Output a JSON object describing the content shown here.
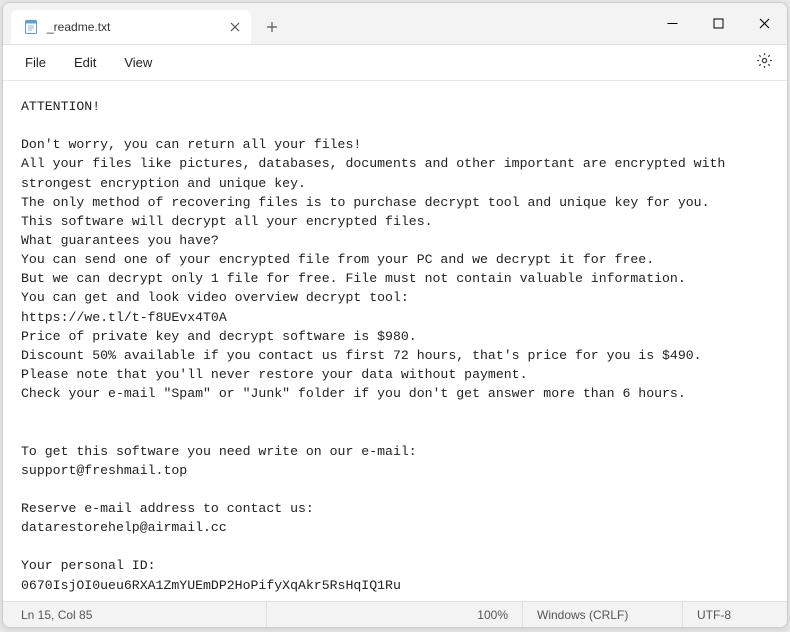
{
  "tab": {
    "title": "_readme.txt"
  },
  "menu": {
    "file": "File",
    "edit": "Edit",
    "view": "View"
  },
  "body": {
    "text": "ATTENTION!\n\nDon't worry, you can return all your files!\nAll your files like pictures, databases, documents and other important are encrypted with strongest encryption and unique key.\nThe only method of recovering files is to purchase decrypt tool and unique key for you.\nThis software will decrypt all your encrypted files.\nWhat guarantees you have?\nYou can send one of your encrypted file from your PC and we decrypt it for free.\nBut we can decrypt only 1 file for free. File must not contain valuable information.\nYou can get and look video overview decrypt tool:\nhttps://we.tl/t-f8UEvx4T0A\nPrice of private key and decrypt software is $980.\nDiscount 50% available if you contact us first 72 hours, that's price for you is $490.\nPlease note that you'll never restore your data without payment.\nCheck your e-mail \"Spam\" or \"Junk\" folder if you don't get answer more than 6 hours.\n\n\nTo get this software you need write on our e-mail:\nsupport@freshmail.top\n\nReserve e-mail address to contact us:\ndatarestorehelp@airmail.cc\n\nYour personal ID:\n0670IsjOI0ueu6RXA1ZmYUEmDP2HoPifyXqAkr5RsHqIQ1Ru"
  },
  "status": {
    "position": "Ln 15, Col 85",
    "zoom": "100%",
    "lineending": "Windows (CRLF)",
    "encoding": "UTF-8"
  }
}
